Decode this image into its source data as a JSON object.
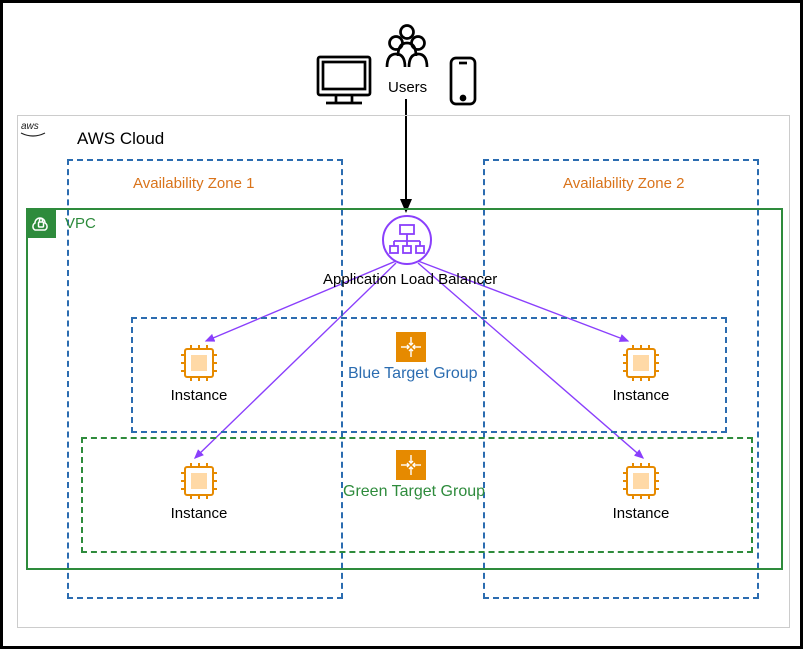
{
  "users_label": "Users",
  "cloud_label": "AWS Cloud",
  "vpc_label": "VPC",
  "az1_label": "Availability Zone 1",
  "az2_label": "Availability Zone 2",
  "alb_label": "Application Load Balancer",
  "blue_tg_label": "Blue Target Group",
  "green_tg_label": "Green Target Group",
  "instance_label": "Instance",
  "colors": {
    "az_border": "#2b6cb0",
    "vpc_border": "#2e8b3c",
    "alb_purple": "#8a3ffc",
    "instance_orange": "#e68a00",
    "tg_blue_text": "#2b6cb0",
    "tg_green_text": "#2e8b3c",
    "az_text": "#d9731a"
  }
}
